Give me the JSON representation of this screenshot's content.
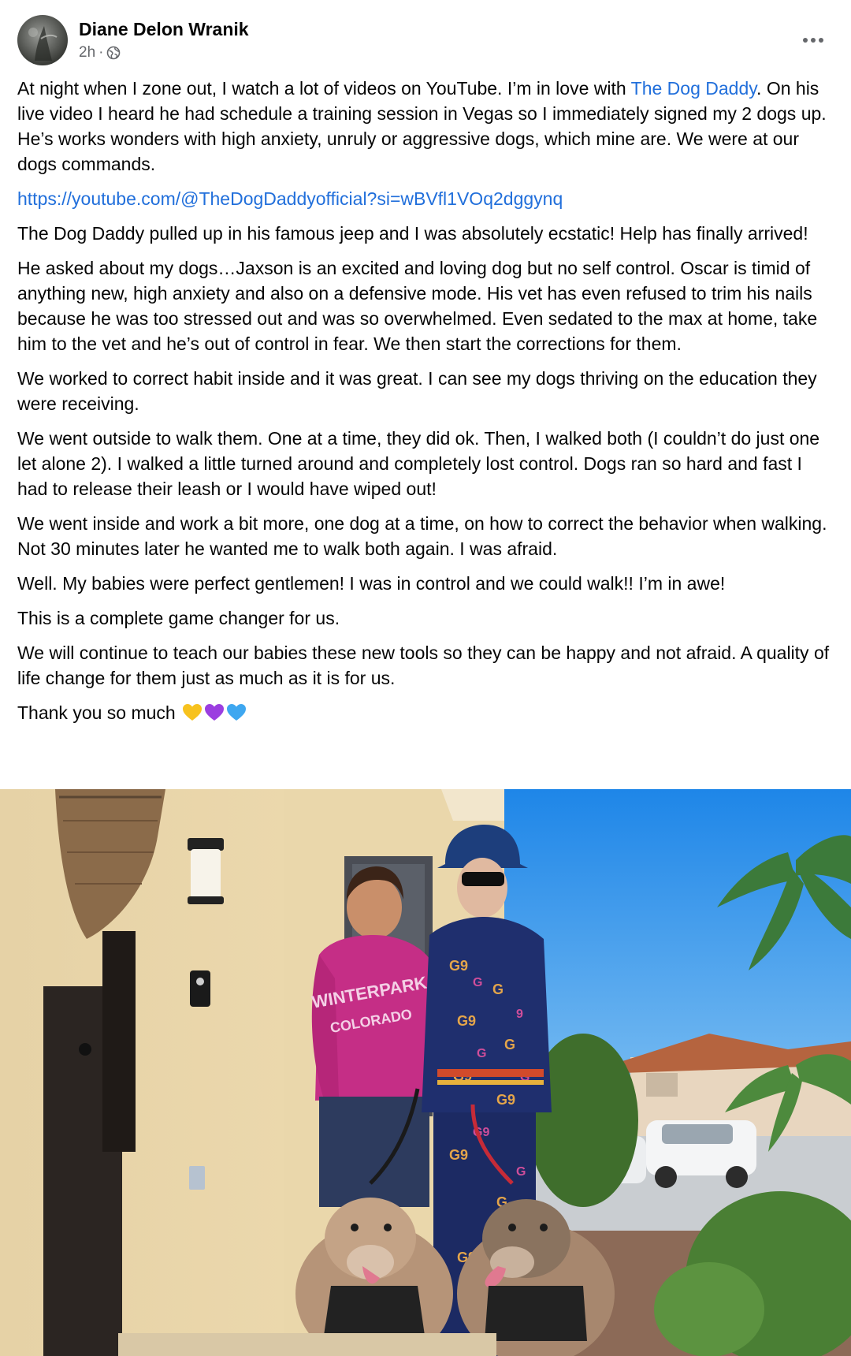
{
  "post": {
    "author": "Diane Delon Wranik",
    "time": "2h",
    "separator": "·",
    "audience_icon": "globe-icon",
    "menu_icon": "more-options-icon",
    "paragraphs": {
      "p1_before": "At night when I zone out, I watch a lot of videos on YouTube. I’m in love with ",
      "p1_link": "The Dog Daddy",
      "p1_after": ". On his live video I heard he had schedule a training session in Vegas so I immediately signed my 2 dogs up. He’s works wonders with high anxiety, unruly or aggressive dogs, which mine are. We were at our dogs commands.",
      "url": "https://youtube.com/@TheDogDaddyofficial?si=wBVfl1VOq2dggynq",
      "p2": "The Dog Daddy pulled up in his famous jeep and I was absolutely ecstatic! Help has finally arrived!",
      "p3": "He asked about my dogs…Jaxson is an excited and loving dog but no self control. Oscar is timid of anything new, high anxiety and also on a defensive mode.  His vet has even refused to trim his nails because he was too stressed out and was so overwhelmed. Even sedated to the max at home, take him to the vet and he’s out of control in fear. We then start the corrections for them.",
      "p4": "We worked to correct habit inside and it was great. I can see my dogs thriving on the education they were receiving.",
      "p5": "We went outside to walk them. One at a time, they did ok. Then, I walked both (I couldn’t do just one let alone 2). I walked a little turned around and completely lost control. Dogs ran so hard and fast I had to release their leash or I would have wiped out!",
      "p6": "We went inside and work a bit more, one dog at a time, on how to correct the behavior when walking. Not 30 minutes later he wanted me to walk both again. I was afraid.",
      "p7": "Well. My babies were perfect gentlemen! I was in control and we could walk!! I’m in awe!",
      "p8": "This is a complete game changer for us.",
      "p9": "We will continue to teach our babies these new tools so they can be happy and not afraid. A quality of life change for them just as much as it is for us.",
      "p10": "Thank you so much"
    },
    "emojis": [
      "yellow-heart-icon",
      "purple-heart-icon",
      "blue-heart-icon"
    ],
    "colors": {
      "link": "#216fdb",
      "secondary_text": "#65676b",
      "yellow_heart": "#f7c21e",
      "purple_heart": "#9b3ee0",
      "blue_heart": "#3ea7f0"
    },
    "photo": {
      "sweatshirt_text_1": "WINTERPARK",
      "sweatshirt_text_2": "COLORADO"
    }
  }
}
